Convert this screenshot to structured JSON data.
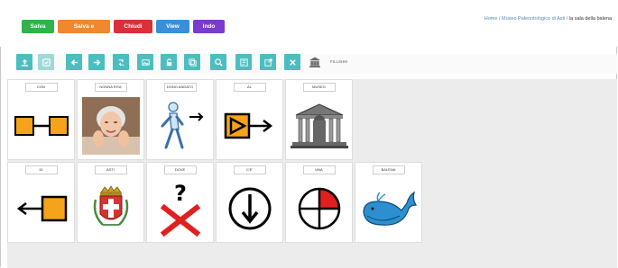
{
  "header": {
    "buttons": [
      {
        "label": "Salva",
        "color": "#2fb34a"
      },
      {
        "label": "Salva e Chiudi",
        "color": "#f0882d"
      },
      {
        "label": "Chiudi",
        "color": "#d9303a"
      },
      {
        "label": "View",
        "color": "#3a8fd9"
      },
      {
        "label": "Indo",
        "color": "#7a3ccc"
      }
    ],
    "breadcrumb": {
      "links": "Home / Museo Paleontologico di Asti /",
      "current": "la sala della balena"
    }
  },
  "toolbar": {
    "accent": "#4cbec0",
    "icons": [
      "upload-icon",
      "save-icon",
      "arrow-left-icon",
      "arrow-right-icon",
      "rotate-icon",
      "image-icon",
      "lock-icon",
      "copy-icon",
      "search-icon",
      "clear-cell-icon",
      "export-icon",
      "delete-icon"
    ],
    "tail_label": "FILLSHM"
  },
  "cards": {
    "row1": [
      {
        "label": "CON",
        "symbol": "with"
      },
      {
        "label": "NONNA RITA",
        "symbol": "photo"
      },
      {
        "label": "DONO ANDATO",
        "symbol": "walk"
      },
      {
        "label": "AL",
        "symbol": "to"
      },
      {
        "label": "MUSEO",
        "symbol": "museum"
      }
    ],
    "row2": [
      {
        "label": "DI",
        "symbol": "from"
      },
      {
        "label": "ASTI",
        "symbol": "crest"
      },
      {
        "label": "DOVE",
        "symbol": "where"
      },
      {
        "label": "C'E'",
        "symbol": "there-is"
      },
      {
        "label": "UNA",
        "symbol": "one"
      },
      {
        "label": "BALENA",
        "symbol": "whale"
      }
    ]
  }
}
